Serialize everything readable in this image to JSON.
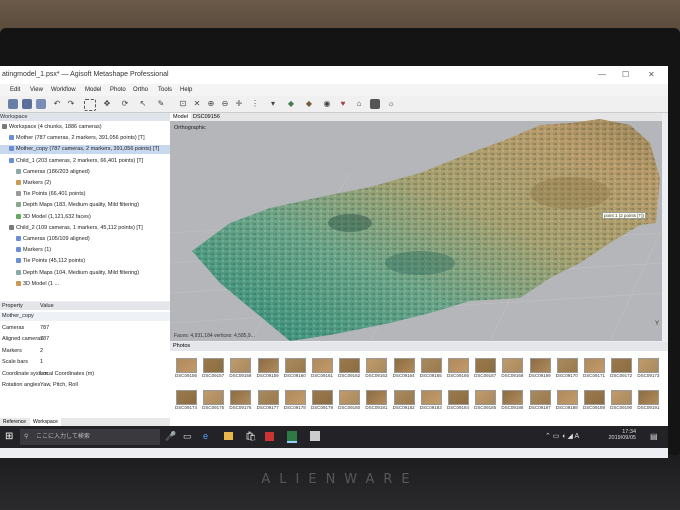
{
  "window": {
    "title": "atingmodel_1.psx* — Agisoft Metashape Professional",
    "minimize": "—",
    "maximize": "☐",
    "close": "✕"
  },
  "menu": [
    "Edit",
    "View",
    "Workflow",
    "Model",
    "Photo",
    "Ortho",
    "Tools",
    "Help"
  ],
  "workspace": {
    "label": "Workspace",
    "items": [
      {
        "text": "Workspace (4 chunks, 1886 cameras)",
        "level": 0,
        "selected": false
      },
      {
        "text": "Mother (787 cameras, 2 markers, 391,056 points) [T]",
        "level": 1,
        "selected": false
      },
      {
        "text": "Mother_copy (787 cameras, 2 markers, 391,056 points) [T]",
        "level": 1,
        "selected": true
      },
      {
        "text": "Child_1 (203 cameras, 2 markers, 66,401 points) [T]",
        "level": 1,
        "selected": false
      },
      {
        "text": "Cameras (186/203 aligned)",
        "level": 2,
        "selected": false
      },
      {
        "text": "Markers (2)",
        "level": 2,
        "selected": false
      },
      {
        "text": "Tie Points (66,401 points)",
        "level": 2,
        "selected": false
      },
      {
        "text": "Depth Maps (183, Medium quality, Mild filtering)",
        "level": 2,
        "selected": false
      },
      {
        "text": "3D Model (1,121,632 faces)",
        "level": 2,
        "selected": false
      },
      {
        "text": "Child_2 (109 cameras, 1 markers, 45,112 points) [T]",
        "level": 1,
        "selected": false
      },
      {
        "text": "Cameras (105/109 aligned)",
        "level": 2,
        "selected": false
      },
      {
        "text": "Markers (1)",
        "level": 2,
        "selected": false
      },
      {
        "text": "Tie Points (45,112 points)",
        "level": 2,
        "selected": false
      },
      {
        "text": "Depth Maps (104, Medium quality, Mild filtering)",
        "level": 2,
        "selected": false
      },
      {
        "text": "3D Model (1 ...",
        "level": 2,
        "selected": false
      }
    ]
  },
  "properties": {
    "header_property": "Property",
    "header_value": "Value",
    "rows": [
      {
        "k": "Mother_copy",
        "v": ""
      },
      {
        "k": "Cameras",
        "v": "787"
      },
      {
        "k": "Aligned cameras",
        "v": "787"
      },
      {
        "k": "Markers",
        "v": "2"
      },
      {
        "k": "Scale bars",
        "v": "1"
      },
      {
        "k": "Coordinate system",
        "v": "Local Coordinates (m)"
      },
      {
        "k": "Rotation angles",
        "v": "Yaw, Pitch, Roll"
      }
    ],
    "tabs": [
      "Reference",
      "Workspace"
    ]
  },
  "model": {
    "tabs": [
      "Model",
      "DSC09156"
    ],
    "view_label": "Orthographic",
    "marker_label": "point 1 (2 points [T])",
    "info": "Faces: 4,931,184 vertices: 4,585,9..."
  },
  "photos": {
    "label": "Photos",
    "row1": [
      "DSC09156",
      "DSC09157",
      "DSC09158",
      "DSC09159",
      "DSC09160",
      "DSC09161",
      "DSC09162",
      "DSC09163",
      "DSC09164",
      "DSC09165",
      "DSC09166",
      "DSC09167",
      "DSC09168",
      "DSC09169",
      "DSC09170",
      "DSC09171",
      "DSC09172",
      "DSC09173"
    ],
    "row2": [
      "DSC09174",
      "DSC09175",
      "DSC09176",
      "DSC09177",
      "DSC09178",
      "DSC09179",
      "DSC09180",
      "DSC09181",
      "DSC09182",
      "DSC09183",
      "DSC09184",
      "DSC09185",
      "DSC09186",
      "DSC09187",
      "DSC09188",
      "DSC09189",
      "DSC09190",
      "DSC09191"
    ]
  },
  "taskbar": {
    "search_placeholder": "ここに入力して検索",
    "time": "17:34",
    "date": "2019/09/05"
  },
  "brand": "ALIENWARE",
  "colors": {
    "selection": "#c8d8ef",
    "model_bg": "#b4b6b9",
    "taskbar": "#232327"
  }
}
